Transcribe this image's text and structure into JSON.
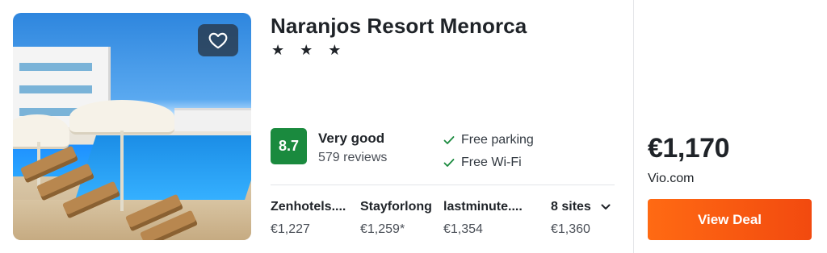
{
  "hotel": {
    "name": "Naranjos Resort Menorca",
    "stars": "★ ★ ★",
    "star_count": 3
  },
  "rating": {
    "score": "8.7",
    "label": "Very good",
    "reviews": "579 reviews",
    "score_color": "#1a8a3e"
  },
  "amenities": [
    "Free parking",
    "Free Wi-Fi"
  ],
  "sites": [
    {
      "name": "Zenhotels....",
      "price": "€1,227"
    },
    {
      "name": "Stayforlong",
      "price": "€1,259*"
    },
    {
      "name": "lastminute....",
      "price": "€1,354"
    },
    {
      "name": "8 sites",
      "price": "€1,360"
    }
  ],
  "deal": {
    "price": "€1,170",
    "provider": "Vio.com",
    "button_label": "View Deal",
    "button_color": "#f4560f"
  },
  "icons": {
    "favorite": "heart-icon",
    "amenity": "checkmark-icon",
    "more_sites": "chevron-down-icon"
  }
}
